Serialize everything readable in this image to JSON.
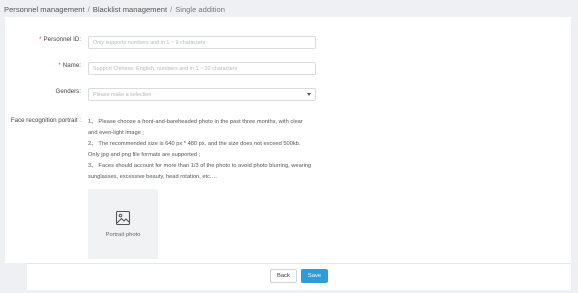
{
  "breadcrumb": {
    "items": [
      "Personnel management",
      "Blacklist management",
      "Single addition"
    ],
    "separator": "/"
  },
  "form": {
    "required_mark": "*",
    "personnel_id": {
      "label": "Personnel ID:",
      "placeholder": "Only supports numbers and in 1 ~ 9 characters"
    },
    "name": {
      "label": "Name:",
      "placeholder": "Support Chinese, English, numbers and in 1 ~ 32 characters"
    },
    "genders": {
      "label": "Genders:",
      "placeholder": "Please make a selection"
    },
    "face": {
      "label": "Face recognition portrait :",
      "instructions": [
        "1、 Please choose a front-and-bareheaded photo in the past three months, with clear and even-light image ;",
        "2、 The recommended size is 640 px * 480 px, and the size does not exceed 500kb. Only jpg and png file formats are supported ;",
        "3、 Faces should account for more than 1/3 of the photo to avoid photo blurring, wearing sunglasses, excessive beauty, head rotation, etc.…"
      ],
      "upload_label": "Portrait photo",
      "upload_icon": "image-icon"
    }
  },
  "footer": {
    "back_label": "Back",
    "save_label": "Save"
  },
  "colors": {
    "accent": "#2d9cdb",
    "required": "#e5484d",
    "page_bg": "#eef0f3"
  }
}
